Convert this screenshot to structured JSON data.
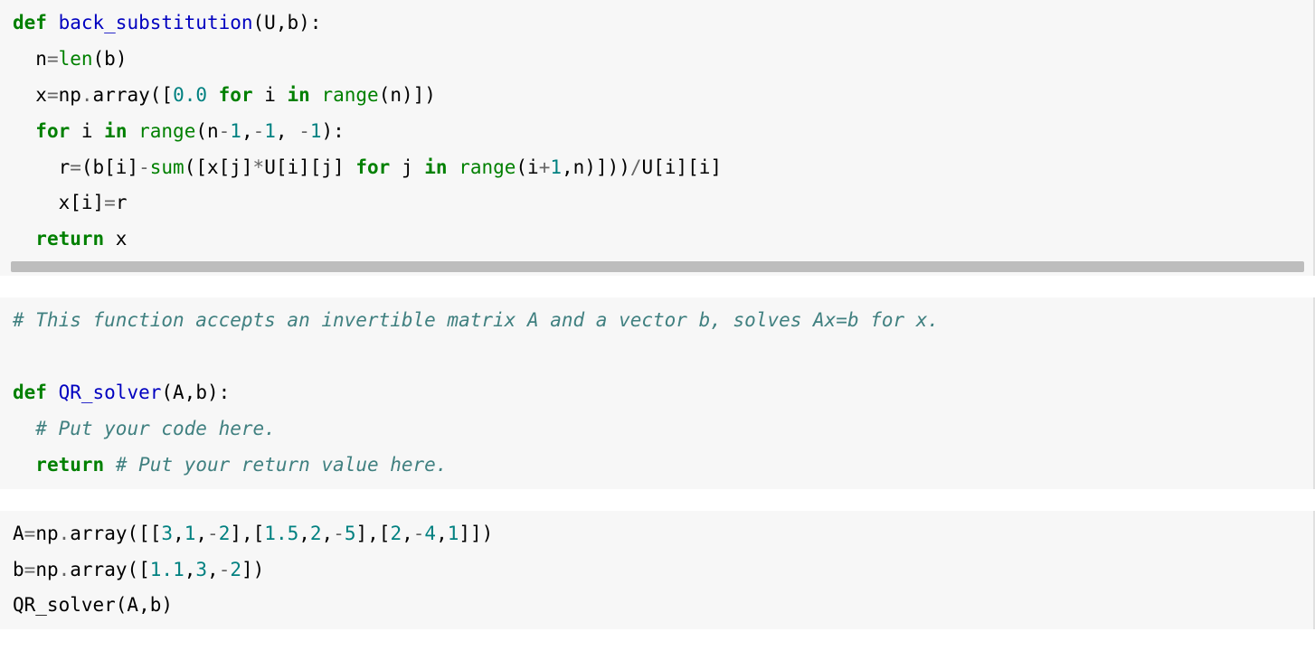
{
  "cells": [
    {
      "type": "code",
      "has_scroll_hint": true,
      "lines": [
        [
          {
            "cls": "kw",
            "t": "def"
          },
          {
            "cls": "id",
            "t": " "
          },
          {
            "cls": "nf",
            "t": "back_substitution"
          },
          {
            "cls": "id",
            "t": "(U,b):"
          }
        ],
        [
          {
            "cls": "id",
            "t": "  n"
          },
          {
            "cls": "op",
            "t": "="
          },
          {
            "cls": "bi",
            "t": "len"
          },
          {
            "cls": "id",
            "t": "(b)"
          }
        ],
        [
          {
            "cls": "id",
            "t": "  x"
          },
          {
            "cls": "op",
            "t": "="
          },
          {
            "cls": "id",
            "t": "np"
          },
          {
            "cls": "op",
            "t": "."
          },
          {
            "cls": "id",
            "t": "array(["
          },
          {
            "cls": "num",
            "t": "0.0"
          },
          {
            "cls": "id",
            "t": " "
          },
          {
            "cls": "kw",
            "t": "for"
          },
          {
            "cls": "id",
            "t": " i "
          },
          {
            "cls": "kw",
            "t": "in"
          },
          {
            "cls": "id",
            "t": " "
          },
          {
            "cls": "bi",
            "t": "range"
          },
          {
            "cls": "id",
            "t": "(n)])"
          }
        ],
        [
          {
            "cls": "id",
            "t": "  "
          },
          {
            "cls": "kw",
            "t": "for"
          },
          {
            "cls": "id",
            "t": " i "
          },
          {
            "cls": "kw",
            "t": "in"
          },
          {
            "cls": "id",
            "t": " "
          },
          {
            "cls": "bi",
            "t": "range"
          },
          {
            "cls": "id",
            "t": "(n"
          },
          {
            "cls": "op",
            "t": "-"
          },
          {
            "cls": "num",
            "t": "1"
          },
          {
            "cls": "id",
            "t": ","
          },
          {
            "cls": "op",
            "t": "-"
          },
          {
            "cls": "num",
            "t": "1"
          },
          {
            "cls": "id",
            "t": ", "
          },
          {
            "cls": "op",
            "t": "-"
          },
          {
            "cls": "num",
            "t": "1"
          },
          {
            "cls": "id",
            "t": "):"
          }
        ],
        [
          {
            "cls": "id",
            "t": "    r"
          },
          {
            "cls": "op",
            "t": "="
          },
          {
            "cls": "id",
            "t": "(b[i]"
          },
          {
            "cls": "op",
            "t": "-"
          },
          {
            "cls": "bi",
            "t": "sum"
          },
          {
            "cls": "id",
            "t": "([x[j]"
          },
          {
            "cls": "op",
            "t": "*"
          },
          {
            "cls": "id",
            "t": "U[i][j] "
          },
          {
            "cls": "kw",
            "t": "for"
          },
          {
            "cls": "id",
            "t": " j "
          },
          {
            "cls": "kw",
            "t": "in"
          },
          {
            "cls": "id",
            "t": " "
          },
          {
            "cls": "bi",
            "t": "range"
          },
          {
            "cls": "id",
            "t": "(i"
          },
          {
            "cls": "op",
            "t": "+"
          },
          {
            "cls": "num",
            "t": "1"
          },
          {
            "cls": "id",
            "t": ",n)]))"
          },
          {
            "cls": "op",
            "t": "/"
          },
          {
            "cls": "id",
            "t": "U[i][i]"
          }
        ],
        [
          {
            "cls": "id",
            "t": "    x[i]"
          },
          {
            "cls": "op",
            "t": "="
          },
          {
            "cls": "id",
            "t": "r"
          }
        ],
        [
          {
            "cls": "id",
            "t": "  "
          },
          {
            "cls": "kw",
            "t": "return"
          },
          {
            "cls": "id",
            "t": " x"
          }
        ]
      ]
    },
    {
      "type": "code",
      "has_scroll_hint": false,
      "lines": [
        [
          {
            "cls": "cm",
            "t": "# This function accepts an invertible matrix A and a vector b, solves Ax=b for x."
          }
        ],
        [
          {
            "cls": "id",
            "t": ""
          }
        ],
        [
          {
            "cls": "kw",
            "t": "def"
          },
          {
            "cls": "id",
            "t": " "
          },
          {
            "cls": "nf",
            "t": "QR_solver"
          },
          {
            "cls": "id",
            "t": "(A,b):"
          }
        ],
        [
          {
            "cls": "id",
            "t": "  "
          },
          {
            "cls": "cm",
            "t": "# Put your code here."
          }
        ],
        [
          {
            "cls": "id",
            "t": "  "
          },
          {
            "cls": "kw",
            "t": "return"
          },
          {
            "cls": "id",
            "t": " "
          },
          {
            "cls": "cm",
            "t": "# Put your return value here."
          }
        ]
      ]
    },
    {
      "type": "code",
      "has_scroll_hint": false,
      "lines": [
        [
          {
            "cls": "id",
            "t": "A"
          },
          {
            "cls": "op",
            "t": "="
          },
          {
            "cls": "id",
            "t": "np"
          },
          {
            "cls": "op",
            "t": "."
          },
          {
            "cls": "id",
            "t": "array([["
          },
          {
            "cls": "num",
            "t": "3"
          },
          {
            "cls": "id",
            "t": ","
          },
          {
            "cls": "num",
            "t": "1"
          },
          {
            "cls": "id",
            "t": ","
          },
          {
            "cls": "op",
            "t": "-"
          },
          {
            "cls": "num",
            "t": "2"
          },
          {
            "cls": "id",
            "t": "],["
          },
          {
            "cls": "num",
            "t": "1.5"
          },
          {
            "cls": "id",
            "t": ","
          },
          {
            "cls": "num",
            "t": "2"
          },
          {
            "cls": "id",
            "t": ","
          },
          {
            "cls": "op",
            "t": "-"
          },
          {
            "cls": "num",
            "t": "5"
          },
          {
            "cls": "id",
            "t": "],["
          },
          {
            "cls": "num",
            "t": "2"
          },
          {
            "cls": "id",
            "t": ","
          },
          {
            "cls": "op",
            "t": "-"
          },
          {
            "cls": "num",
            "t": "4"
          },
          {
            "cls": "id",
            "t": ","
          },
          {
            "cls": "num",
            "t": "1"
          },
          {
            "cls": "id",
            "t": "]])"
          }
        ],
        [
          {
            "cls": "id",
            "t": "b"
          },
          {
            "cls": "op",
            "t": "="
          },
          {
            "cls": "id",
            "t": "np"
          },
          {
            "cls": "op",
            "t": "."
          },
          {
            "cls": "id",
            "t": "array(["
          },
          {
            "cls": "num",
            "t": "1.1"
          },
          {
            "cls": "id",
            "t": ","
          },
          {
            "cls": "num",
            "t": "3"
          },
          {
            "cls": "id",
            "t": ","
          },
          {
            "cls": "op",
            "t": "-"
          },
          {
            "cls": "num",
            "t": "2"
          },
          {
            "cls": "id",
            "t": "])"
          }
        ],
        [
          {
            "cls": "id",
            "t": "QR_solver(A,b)"
          }
        ]
      ]
    }
  ]
}
